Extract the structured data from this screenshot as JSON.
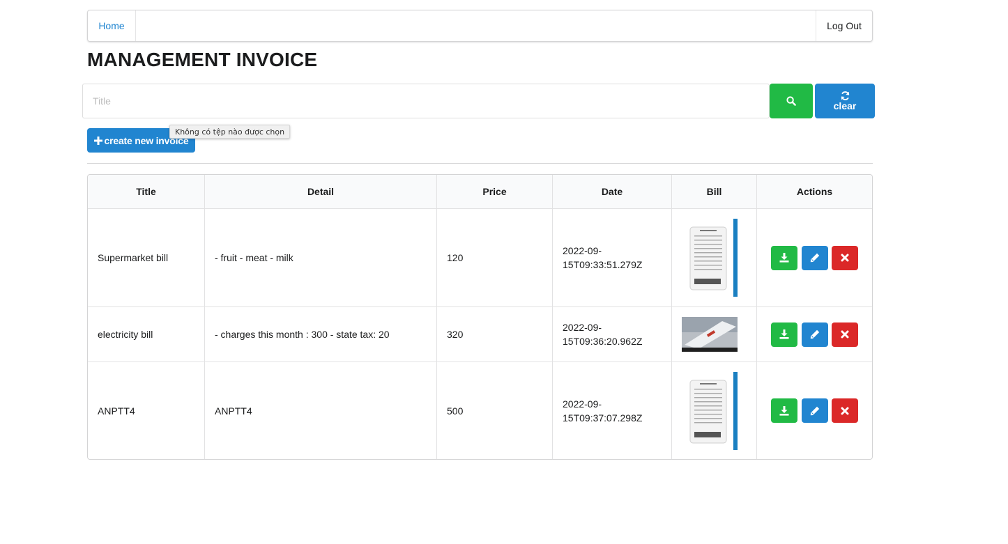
{
  "nav": {
    "home_label": "Home",
    "logout_label": "Log Out"
  },
  "page": {
    "title": "MANAGEMENT INVOICE"
  },
  "search": {
    "placeholder": "Title",
    "clear_label": "clear"
  },
  "create": {
    "label": "create new invoice"
  },
  "file_tooltip": "Không có tệp nào được chọn",
  "table": {
    "headers": [
      "Title",
      "Detail",
      "Price",
      "Date",
      "Bill",
      "Actions"
    ],
    "rows": [
      {
        "title": "Supermarket bill",
        "detail": "- fruit - meat - milk",
        "price": "120",
        "date_line1": "2022-09-",
        "date_line2": "15T09:33:51.279Z",
        "bill_icon": "receipt-image"
      },
      {
        "title": "electricity bill",
        "detail": "- charges this month : 300 - state tax: 20",
        "price": "320",
        "date_line1": "2022-09-",
        "date_line2": "15T09:36:20.962Z",
        "bill_icon": "bill-photo"
      },
      {
        "title": "ANPTT4",
        "detail": "ANPTT4",
        "price": "500",
        "date_line1": "2022-09-",
        "date_line2": "15T09:37:07.298Z",
        "bill_icon": "receipt-image"
      }
    ]
  },
  "icons": {
    "search": "search-icon",
    "clear": "refresh-icon",
    "create": "plus-icon",
    "download": "download-icon",
    "edit": "pencil-icon",
    "delete": "close-icon"
  },
  "colors": {
    "green": "#21ba45",
    "blue": "#2185d0",
    "red": "#db2828",
    "link": "#2185d0"
  }
}
